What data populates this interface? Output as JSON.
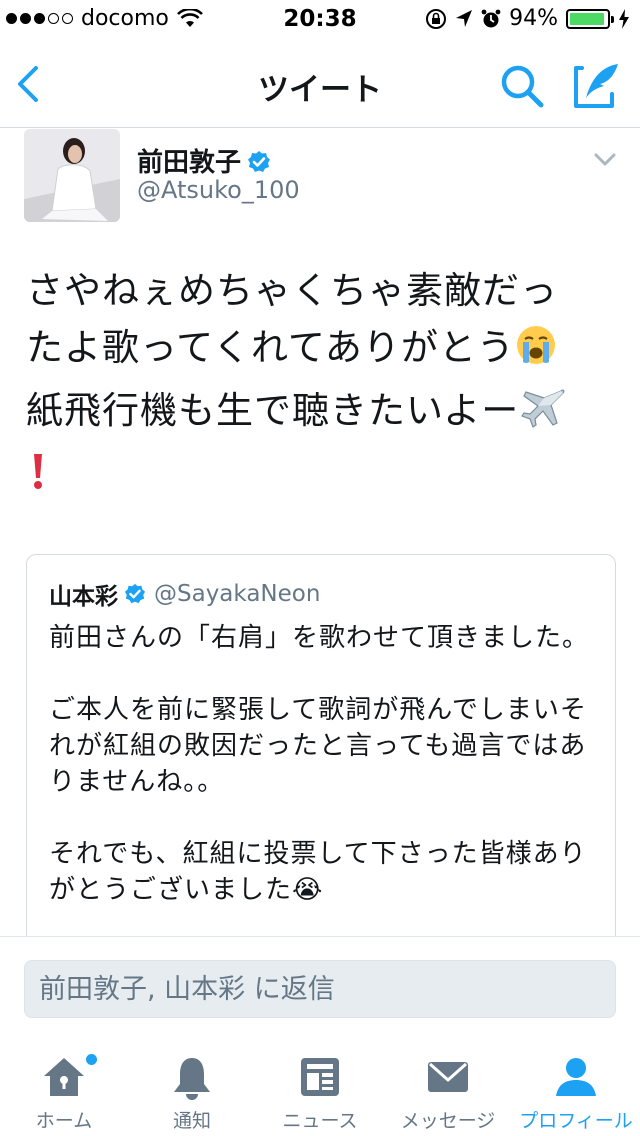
{
  "status_bar": {
    "carrier": "docomo",
    "time": "20:38",
    "battery_percent": "94%",
    "signal_bars_filled": 3,
    "signal_bars_total": 5
  },
  "nav": {
    "title": "ツイート",
    "back_icon": "chevron-left-icon",
    "search_icon": "search-icon",
    "compose_icon": "compose-icon"
  },
  "tweet": {
    "author_name": "前田敦子",
    "author_handle": "@Atsuko_100",
    "verified": true,
    "text_line1": "さやねぇめちゃくちゃ素敵だっ",
    "text_line2": "たよ歌ってくれてありがとう",
    "text_line3": "紙飛行機も生で聴きたいよー",
    "emoji_crying": "😭",
    "emoji_airplane": "✈️",
    "emoji_exclamation": "❗"
  },
  "quoted_tweet": {
    "author_name": "山本彩",
    "author_handle": "@SayakaNeon",
    "verified": true,
    "text": "前田さんの「右肩」を歌わせて頂きました。\n\nご本人を前に緊張して歌詞が飛んでしまいそれが紅組の敗因だったと言っても過言ではありませんね。。\n\nそれでも、紅組に投票して下さった皆様ありがとうございました😭"
  },
  "reply": {
    "placeholder": "前田敦子, 山本彩 に返信"
  },
  "tab_bar": {
    "tabs": [
      {
        "label": "ホーム",
        "icon": "home-icon",
        "active": false,
        "has_notification_dot": true
      },
      {
        "label": "通知",
        "icon": "bell-icon",
        "active": false
      },
      {
        "label": "ニュース",
        "icon": "news-icon",
        "active": false
      },
      {
        "label": "メッセージ",
        "icon": "envelope-icon",
        "active": false
      },
      {
        "label": "プロフィール",
        "icon": "profile-icon",
        "active": true
      }
    ]
  },
  "colors": {
    "accent": "#1da1f2",
    "text_primary": "#14171a",
    "text_secondary": "#657786",
    "battery": "#4cd964",
    "exclamation": "#dd2e44"
  }
}
